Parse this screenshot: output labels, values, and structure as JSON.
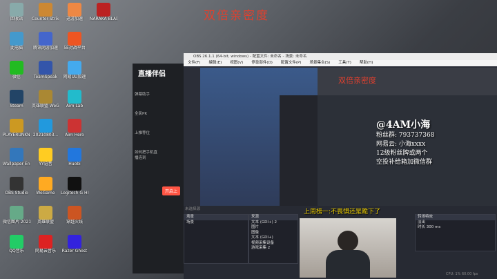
{
  "banner_text": "双倍亲密度",
  "desktop_icons": [
    {
      "label": "回收站",
      "color": "#8aa"
    },
    {
      "label": "Counter-Strike",
      "color": "#c83"
    },
    {
      "label": "迅游加速",
      "color": "#e84"
    },
    {
      "label": "NARAKA BLADEPOI",
      "color": "#b22"
    },
    {
      "label": "此电脑",
      "color": "#49c"
    },
    {
      "label": "腾讯网游加速",
      "color": "#46c"
    },
    {
      "label": "5E对战平台",
      "color": "#e52"
    },
    {
      "label": "微信",
      "color": "#2b2"
    },
    {
      "label": "TeamSpeak",
      "color": "#35a"
    },
    {
      "label": "网易UU加速",
      "color": "#4ae"
    },
    {
      "label": "Steam",
      "color": "#246"
    },
    {
      "label": "英雄联盟 WeGame版",
      "color": "#a83"
    },
    {
      "label": "Aim Lab",
      "color": "#2bc"
    },
    {
      "label": "PLAYERUNKNOWN BATTLEGR...",
      "color": "#c92"
    },
    {
      "label": "20210803...",
      "color": "#29d"
    },
    {
      "label": "Aim Hero",
      "color": "#c33"
    },
    {
      "label": "Wallpaper Engine...",
      "color": "#37b"
    },
    {
      "label": "YY语音",
      "color": "#fc2"
    },
    {
      "label": "Huobi",
      "color": "#27d"
    },
    {
      "label": "OBS Studio",
      "color": "#333"
    },
    {
      "label": "WeGame",
      "color": "#fa2"
    },
    {
      "label": "Logitech G HUB",
      "color": "#111"
    },
    {
      "label": "微信图片 2021031...",
      "color": "#6a8"
    },
    {
      "label": "英雄联盟",
      "color": "#ca4"
    },
    {
      "label": "穿越火线",
      "color": "#c52"
    },
    {
      "label": "QQ音乐",
      "color": "#2c6"
    },
    {
      "label": "网易云音乐",
      "color": "#d22"
    },
    {
      "label": "Razer Ghost",
      "color": "#32d"
    }
  ],
  "live_app": {
    "logo": "直播伴侣",
    "side_items": [
      "弹幕助手",
      "全民PK",
      "上推荐位",
      "如何把手机直播连到"
    ],
    "open_button": "开启上"
  },
  "obs": {
    "title": "OBS 26.1.1 (64-bit, windows) - 配置文件: 未命名 - 场景: 未命名",
    "menu": [
      "文件(F)",
      "编辑(E)",
      "视图(V)",
      "停靠部件(D)",
      "配置文件(P)",
      "场景集合(S)",
      "工具(T)",
      "帮助(H)"
    ],
    "scenes_header": "场景",
    "scene_item": "场景",
    "sources_header": "来源",
    "sources": [
      "文本 (GDI+) 2",
      "图片",
      "图像",
      "文本 (GDI+)",
      "视频采集设备",
      "游戏采集 2"
    ],
    "no_source_selected": "未选择源",
    "transition_header": "转场特效",
    "transition_value": "淡出",
    "duration_label": "时长",
    "duration_value": "300 ms",
    "status": "CPU: 1% 60.00 fps"
  },
  "stream_overlay": {
    "handle": "@4AM小海",
    "lines": [
      "粉丝群: 793737368",
      "网易云: 小海xxxx",
      "12级粉丝牌或两个",
      "空投补给箱加微信群"
    ],
    "caption": "上周榜一:不畏惧还是跪下了"
  }
}
